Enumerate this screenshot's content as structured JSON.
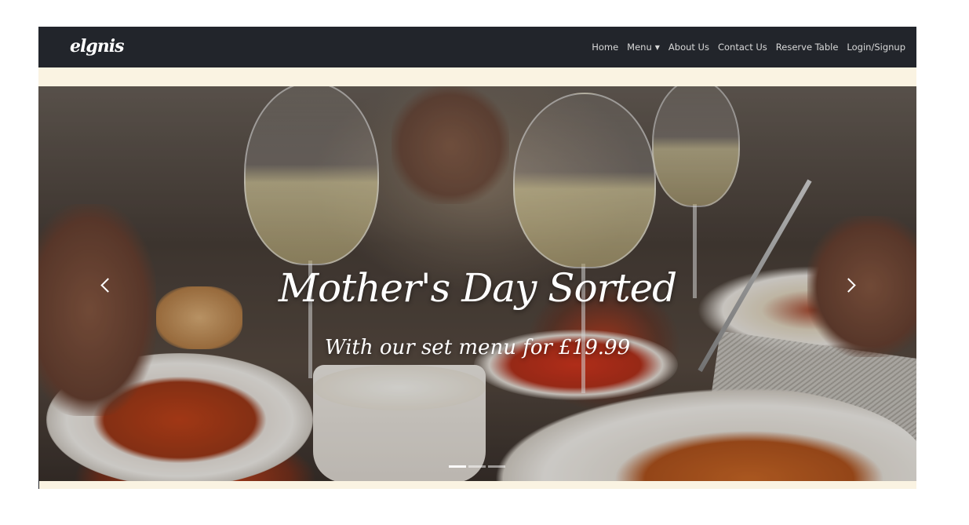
{
  "navbar": {
    "brand": "elgnis",
    "items": [
      {
        "label": "Home"
      },
      {
        "label": "Menu",
        "has_dropdown": true
      },
      {
        "label": "About Us"
      },
      {
        "label": "Contact Us"
      },
      {
        "label": "Reserve Table"
      },
      {
        "label": "Login/Signup"
      }
    ]
  },
  "carousel": {
    "title": "Mother's Day Sorted",
    "subtitle": "With our set menu for £19.99",
    "slide_count": 3,
    "active_index": 0,
    "prev_icon": "chevron-left-icon",
    "next_icon": "chevron-right-icon"
  },
  "colors": {
    "navbar_bg": "#22252b",
    "cream": "#faf3e2",
    "nav_text": "#d9d9d9"
  }
}
